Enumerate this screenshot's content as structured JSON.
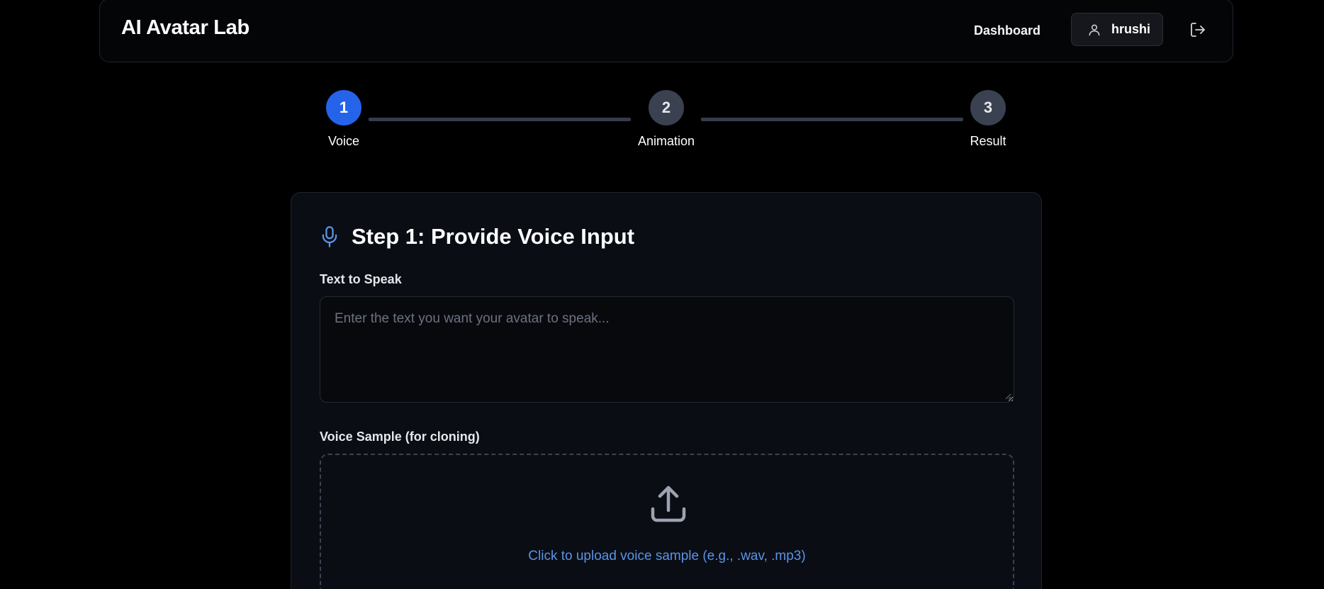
{
  "header": {
    "brand": "AI Avatar Lab",
    "nav_dashboard": "Dashboard",
    "user_name": "hrushi",
    "user_icon": "user-icon",
    "logout_icon": "logout-icon"
  },
  "stepper": {
    "current_step": 1,
    "steps": [
      {
        "number": "1",
        "label": "Voice"
      },
      {
        "number": "2",
        "label": "Animation"
      },
      {
        "number": "3",
        "label": "Result"
      }
    ]
  },
  "step1": {
    "title": "Step 1: Provide Voice Input",
    "title_icon": "microphone-icon",
    "text_label": "Text to Speak",
    "text_placeholder": "Enter the text you want your avatar to speak...",
    "text_value": "",
    "voice_label": "Voice Sample (for cloning)",
    "upload_icon": "upload-icon",
    "upload_text": "Click to upload voice sample (e.g., .wav, .mp3)"
  },
  "colors": {
    "accent": "#2563eb",
    "link": "#5b93e6",
    "background": "#000000",
    "card": "#0a0d14"
  }
}
